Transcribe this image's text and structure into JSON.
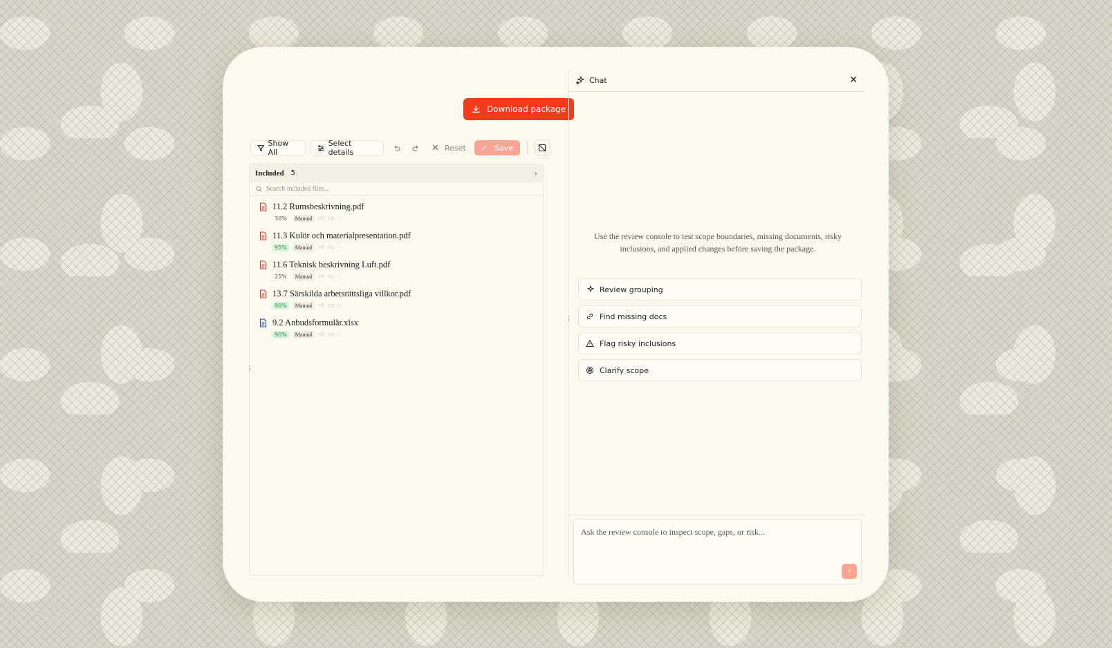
{
  "header": {
    "download_label": "Download package"
  },
  "toolbar": {
    "show_all_label": "Show All",
    "select_details_label": "Select details",
    "reset_label": "Reset",
    "save_label": "Save"
  },
  "included": {
    "heading": "Included",
    "count": "5",
    "search_placeholder": "Search included files...",
    "files": [
      {
        "name": "11.2 Rumsbeskrivning.pdf",
        "pct": "30%",
        "source": "Manual",
        "type": "pdf",
        "pct_level": "low"
      },
      {
        "name": "11.3 Kulör och materialpresentation.pdf",
        "pct": "95%",
        "source": "Manual",
        "type": "pdf",
        "pct_level": "high"
      },
      {
        "name": "11.6 Teknisk beskrivning Luft.pdf",
        "pct": "25%",
        "source": "Manual",
        "type": "pdf",
        "pct_level": "low"
      },
      {
        "name": "13.7 Särskilda arbetsrättsliga villkor.pdf",
        "pct": "90%",
        "source": "Manual",
        "type": "pdf",
        "pct_level": "high"
      },
      {
        "name": "9.2 Anbudsformulär.xlsx",
        "pct": "90%",
        "source": "Manual",
        "type": "xlsx",
        "pct_level": "high"
      }
    ]
  },
  "chat": {
    "title": "Chat",
    "intro": "Use the review console to test scope boundaries, missing documents, risky inclusions, and applied changes before saving the package.",
    "suggestions": [
      {
        "label": "Review grouping",
        "icon": "sparkle-icon"
      },
      {
        "label": "Find missing docs",
        "icon": "link-icon"
      },
      {
        "label": "Flag risky inclusions",
        "icon": "warning-icon"
      },
      {
        "label": "Clarify scope",
        "icon": "target-icon"
      }
    ],
    "input_placeholder": "Ask the review console to inspect scope, gaps, or risk..."
  },
  "colors": {
    "accent": "#f23a1d",
    "accent_soft": "#f9a596",
    "surface": "#fcf9ee"
  }
}
